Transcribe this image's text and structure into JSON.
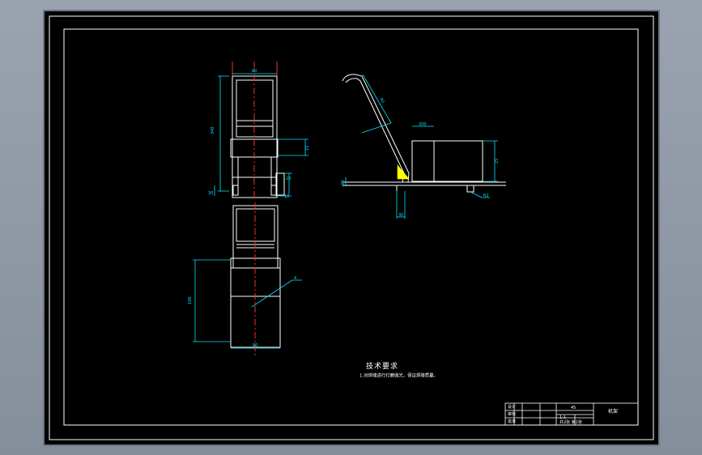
{
  "dimensions": {
    "top_width": "80",
    "left_height": "340",
    "offset_small": "15",
    "pin_height": "20",
    "foot_left": "30",
    "foot_right": "10",
    "bottom_height": "100",
    "bottom_width": "80",
    "weld_leader": "4",
    "arm_length": "40",
    "tray_width": "200",
    "tray_height": "25",
    "base_left": "40",
    "post_width": "30",
    "foot_r": "R2"
  },
  "notes": {
    "title": "技术要求",
    "line1": "1.对焊缝进行打磨抛光，保证焊接质量。"
  },
  "title_block": {
    "drawing_name": "机架",
    "material": "45",
    "scale": "1:1",
    "cell_1": "设计",
    "cell_2": "审核",
    "cell_3": "批准",
    "cell_4": "共2张 第2张"
  },
  "colors": {
    "background": "#000000",
    "frame": "#ffffff",
    "dimension": "#00e5ff",
    "centerline": "#ff2a2a",
    "accent": "#ffff00"
  }
}
